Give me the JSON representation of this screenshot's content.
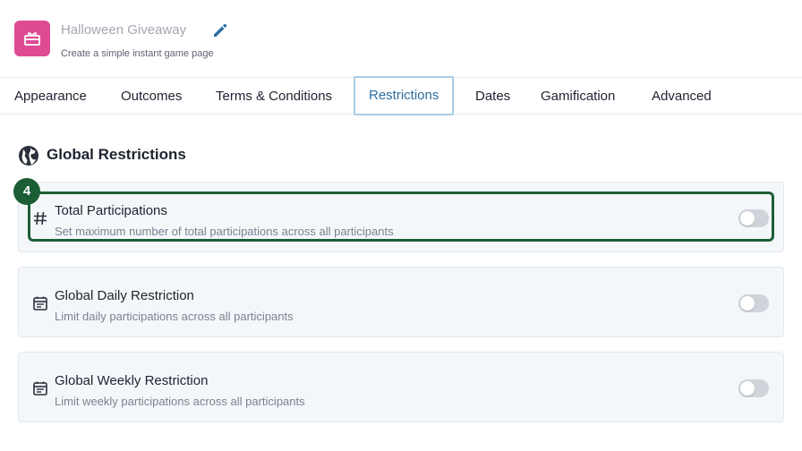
{
  "header": {
    "title": "Halloween Giveaway",
    "subtitle": "Create a simple instant game page",
    "icon": "gift-card-icon",
    "accent_color": "#de4b93"
  },
  "tabs": [
    {
      "label": "Appearance"
    },
    {
      "label": "Outcomes"
    },
    {
      "label": "Terms & Conditions"
    },
    {
      "label": "Restrictions",
      "active": true
    },
    {
      "label": "Dates"
    },
    {
      "label": "Gamification"
    },
    {
      "label": "Advanced"
    }
  ],
  "section": {
    "title": "Global Restrictions",
    "icon": "globe-icon"
  },
  "restrictions": [
    {
      "title": "Total Participations",
      "description": "Set maximum number of total participations across all participants",
      "icon": "hash-icon",
      "enabled": false
    },
    {
      "title": "Global Daily Restriction",
      "description": "Limit daily participations across all participants",
      "icon": "calendar-icon",
      "enabled": false
    },
    {
      "title": "Global Weekly Restriction",
      "description": "Limit weekly participations across all participants",
      "icon": "calendar-icon",
      "enabled": false
    }
  ],
  "annotation": {
    "step": "4",
    "color": "#1b5e35"
  }
}
